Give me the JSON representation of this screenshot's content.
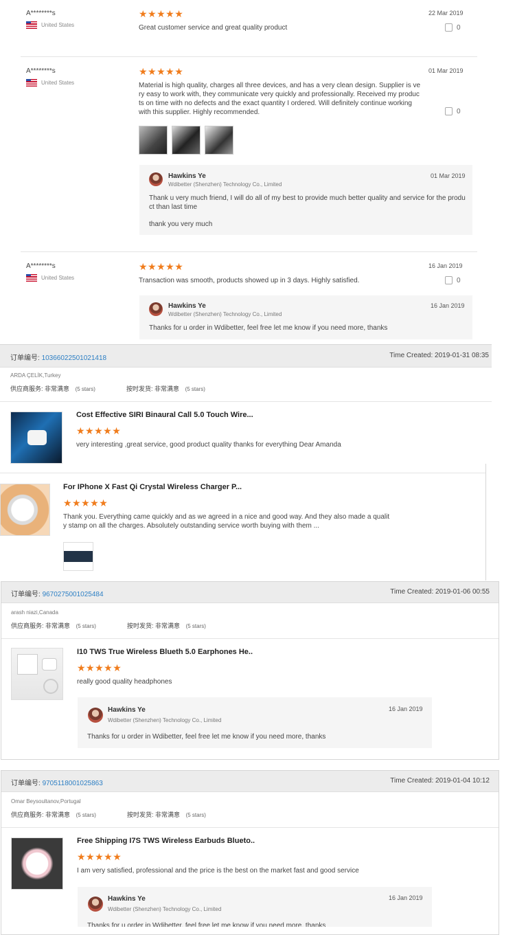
{
  "reviews": [
    {
      "name": "A********s",
      "country": "United States",
      "stars": "★★★★★",
      "date": "22 Mar 2019",
      "text": "Great customer service and great quality product",
      "likes": "0"
    },
    {
      "name": "A********s",
      "country": "United States",
      "stars": "★★★★★",
      "date": "01 Mar 2019",
      "text_lines": [
        "Material is high quality, charges all three devices, and has a very clean design. Supplier is ve",
        "ry easy to work with, they communicate very quickly and professionally. Received my produc",
        "ts on time with no defects and the exact quantity I ordered. Will definitely continue working",
        " with this supplier. Highly recommended."
      ],
      "likes": "0",
      "reply": {
        "name": "Hawkins Ye",
        "company": "Wdibetter (Shenzhen) Technology Co., Limited",
        "date": "01 Mar 2019",
        "line1": "Thank u very much friend, I will do all of my best to provide much better quality and service for the produ",
        "line2": "ct  than last time",
        "line3": "thank you very much"
      }
    },
    {
      "name": "A********s",
      "country": "United States",
      "stars": "★★★★★",
      "date": "16 Jan 2019",
      "text": "Transaction was smooth, products showed up in 3 days. Highly satisfied.",
      "likes": "0",
      "reply": {
        "name": "Hawkins Ye",
        "company": "Wdibetter (Shenzhen) Technology Co., Limited",
        "date": "16 Jan 2019",
        "text": "Thanks for u order in Wdibetter, feel free let me know if you need more, thanks"
      }
    }
  ],
  "orders": [
    {
      "order_label": "订单编号:",
      "order_no": "10366022501021418",
      "time": "Time Created: 2019-01-31 08:35",
      "buyer": "ARDA ÇELİK,Turkey",
      "service_label": "供应商服务:",
      "service_value": "非常满意",
      "service_stars": "(5 stars)",
      "ship_label": "按时发货:",
      "ship_value": "非常满意",
      "ship_stars": "(5 stars)",
      "products": [
        {
          "title": "Cost Effective SIRI Binaural Call 5.0 Touch Wire...",
          "stars": "★★★★★",
          "text": "very interesting ,great service, good product quality thanks for everything Dear Amanda"
        },
        {
          "title": "For IPhone X Fast Qi Crystal Wireless Charger P...",
          "stars": "★★★★★",
          "line1": "Thank you. Everything came quickly and as we agreed in a nice and good way. And they also made a qualit",
          "line2": "y stamp on all the charges. Absolutely outstanding service worth buying with them ..."
        }
      ]
    },
    {
      "order_label": "订单编号:",
      "order_no": "9670275001025484",
      "time": "Time Created: 2019-01-06 00:55",
      "buyer": "arash niazi,Canada",
      "service_label": "供应商服务:",
      "service_value": "非常满意",
      "service_stars": "(5 stars)",
      "ship_label": "按时发货:",
      "ship_value": "非常满意",
      "ship_stars": "(5 stars)",
      "product": {
        "title": "I10 TWS True Wireless Blueth 5.0 Earphones He..",
        "stars": "★★★★★",
        "text": "really good quality headphones"
      },
      "reply": {
        "name": "Hawkins Ye",
        "company": "Wdibetter (Shenzhen) Technology Co., Limited",
        "date": "16 Jan 2019",
        "text": "Thanks for u order in Wdibetter, feel free let me know if you need more, thanks"
      }
    },
    {
      "order_label": "订单编号:",
      "order_no": "9705118001025863",
      "time": "Time Created: 2019-01-04 10:12",
      "buyer": "Omar Beysoultanov,Portugal",
      "service_label": "供应商服务:",
      "service_value": "非常满意",
      "service_stars": "(5 stars)",
      "ship_label": "按时发货:",
      "ship_value": "非常满意",
      "ship_stars": "(5 stars)",
      "product": {
        "title": "Free Shipping I7S TWS Wireless Earbuds Blueto..",
        "stars": "★★★★★",
        "text": "I am very satisfied, professional and the price is the best on the market fast and good service"
      },
      "reply": {
        "name": "Hawkins Ye",
        "company": "Wdibetter (Shenzhen) Technology Co., Limited",
        "date": "16 Jan 2019",
        "text": "Thanks for u order in Wdibetter, feel free let me know if you need more, thanks"
      }
    }
  ],
  "colors": {
    "star": "#f07c1c",
    "link": "#2d7fc4",
    "bar": "#ececec"
  }
}
